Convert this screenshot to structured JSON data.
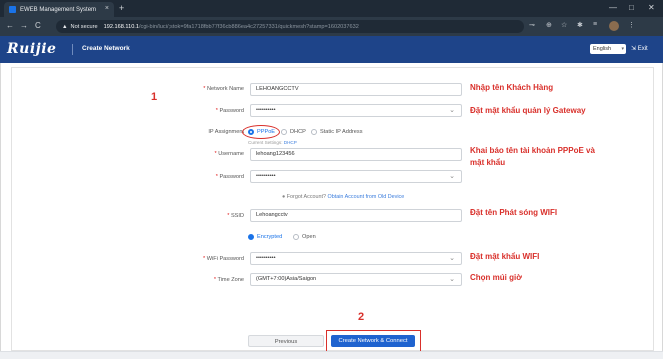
{
  "browser": {
    "tab_title": "EWEB Management System",
    "tab_close": "×",
    "new_tab": "+",
    "window_controls": [
      "—",
      "□",
      "✕"
    ],
    "nav": [
      "←",
      "→",
      "C"
    ],
    "security_warning": "▲",
    "not_secure": "Not secure",
    "url_host": "192.168.110.1",
    "url_path": "/cgi-bin/luci/;stok=9fa1718fbb77f36cb886ea4c27257331/quickmesh?stamp=1602037632"
  },
  "app": {
    "logo_text": "Ruijie",
    "title": "Create Network",
    "language": "English",
    "exit_label": "Exit"
  },
  "form": {
    "network_name": {
      "label": "Network Name",
      "value": "LEHOANGCCTV"
    },
    "password": {
      "label": "Password",
      "value": "••••••••••"
    },
    "ip_assignment": {
      "label": "IP Assignment",
      "options": [
        "PPPoE",
        "DHCP",
        "Static IP Address"
      ],
      "selected": "PPPoE",
      "current_settings_label": "Current Settings:",
      "current_settings_value": "DHCP"
    },
    "username": {
      "label": "Username",
      "value": "lehoang123456"
    },
    "pppoe_password": {
      "label": "Password",
      "value": "••••••••••"
    },
    "forgot_text": "Forgot Account?",
    "forgot_link": "Obtain Account from Old Device",
    "ssid": {
      "label": "SSID",
      "value": "Lehoangcctv"
    },
    "encryption": {
      "options": [
        "Encrypted",
        "Open"
      ],
      "selected": "Encrypted"
    },
    "wifi_password": {
      "label": "WiFi Password",
      "value": "••••••••••"
    },
    "time_zone": {
      "label": "Time Zone",
      "value": "(GMT+7:00)Asia/Saigon"
    }
  },
  "buttons": {
    "previous": "Previous",
    "create": "Create Network & Connect"
  },
  "annotations": {
    "step1": "1",
    "step2": "2",
    "customer_name": "Nhập tên Khách Hàng",
    "gateway_password": "Đặt mật khẩu quản lý Gateway",
    "pppoe_account": "Khai báo tên tài khoản PPPoE và mật khẩu",
    "wifi_name": "Đặt tên Phát sóng WIFI",
    "wifi_password": "Đặt mật khẩu WIFI",
    "timezone": "Chọn múi giờ",
    "color": "#d9302b"
  },
  "colors": {
    "header": "#1e4489",
    "primary_button": "#1f63cf",
    "radio_selected": "#1a73e8",
    "link": "#3b7ddd",
    "required": "#e02020"
  }
}
